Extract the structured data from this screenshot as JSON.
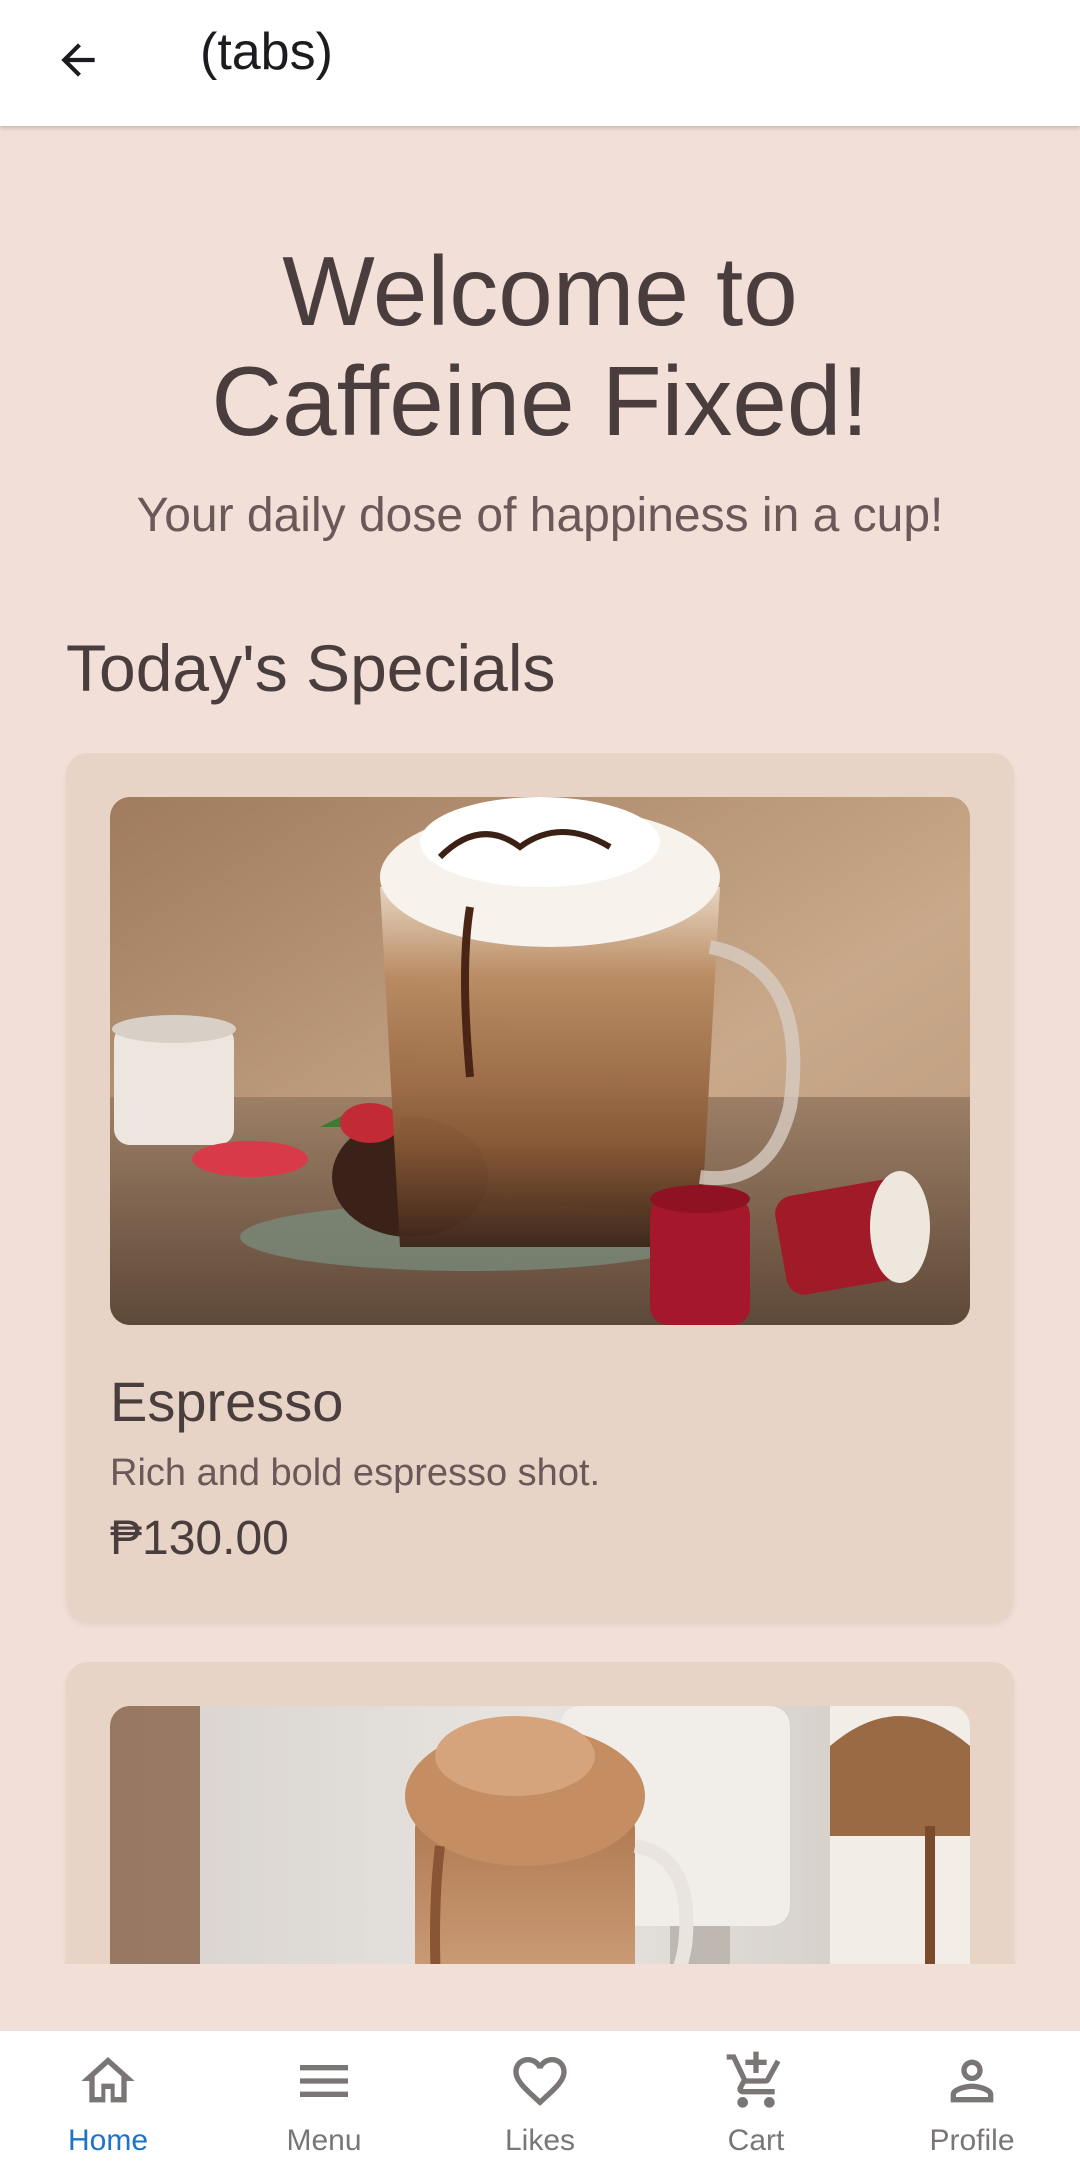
{
  "appbar": {
    "title": "(tabs)",
    "back_icon": "arrow-left-icon"
  },
  "hero": {
    "title": "Welcome to\nCaffeine Fixed!",
    "subtitle": "Your daily dose of happiness in a cup!"
  },
  "specials": {
    "title": "Today's Specials",
    "items": [
      {
        "name": "Espresso",
        "description": "Rich and bold espresso shot.",
        "price": "₱130.00",
        "image": "coffee-with-whipped-cream-photo"
      },
      {
        "image": "dalgona-coffee-photo"
      }
    ]
  },
  "bottom_nav": {
    "items": [
      {
        "label": "Home",
        "icon": "home-icon",
        "active": true
      },
      {
        "label": "Menu",
        "icon": "menu-icon",
        "active": false
      },
      {
        "label": "Likes",
        "icon": "heart-icon",
        "active": false
      },
      {
        "label": "Cart",
        "icon": "cart-add-icon",
        "active": false
      },
      {
        "label": "Profile",
        "icon": "person-icon",
        "active": false
      }
    ]
  },
  "colors": {
    "background": "#f2dfd7",
    "card": "#e8d4c7",
    "text_primary": "#4a3d3d",
    "text_secondary": "#6b5858",
    "nav_active": "#1e73c8",
    "nav_inactive": "#7a7676"
  }
}
